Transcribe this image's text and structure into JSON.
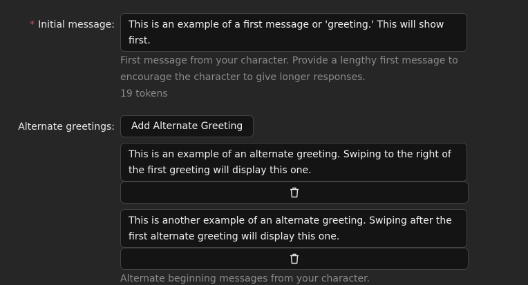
{
  "initial_message": {
    "required_mark": "*",
    "label": "Initial message:",
    "value": "This is an example of a first message or 'greeting.' This will show first.",
    "help": "First message from your character. Provide a lengthy first message to encourage the character to give longer responses.",
    "token_count": "19 tokens"
  },
  "alternate_greetings": {
    "label": "Alternate greetings:",
    "add_button_label": "Add Alternate Greeting",
    "items": [
      {
        "value": "This is an example of an alternate greeting. Swiping to the right of the first greeting will display this one.",
        "delete_icon": "trash-icon"
      },
      {
        "value": "This is another example of an alternate greeting. Swiping after the first alternate greeting will display this one.",
        "delete_icon": "trash-icon"
      }
    ],
    "help": "Alternate beginning messages from your character."
  }
}
